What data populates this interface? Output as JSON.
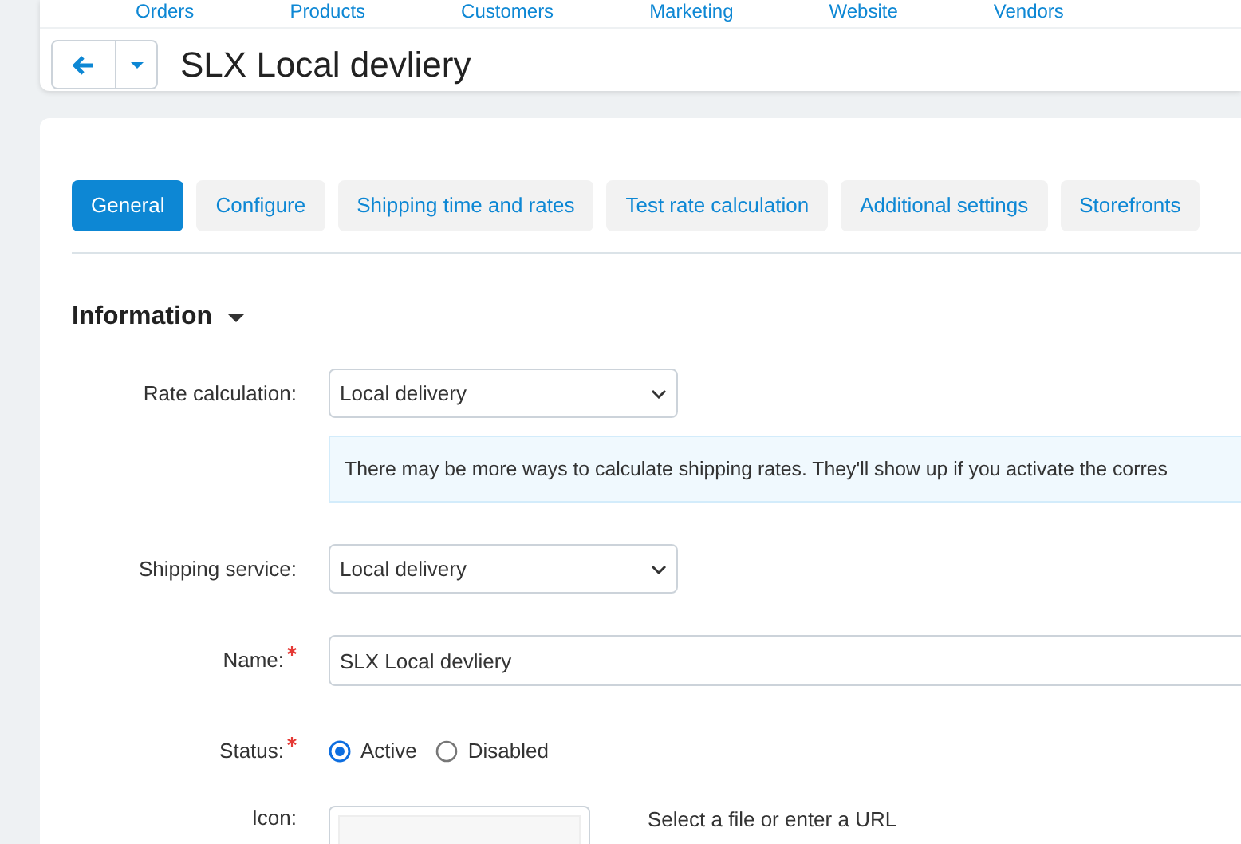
{
  "top_nav": [
    "Orders",
    "Products",
    "Customers",
    "Marketing",
    "Website",
    "Vendors"
  ],
  "header": {
    "title": "SLX Local devliery"
  },
  "tabs": [
    {
      "label": "General",
      "selected": true
    },
    {
      "label": "Configure",
      "selected": false
    },
    {
      "label": "Shipping time and rates",
      "selected": false
    },
    {
      "label": "Test rate calculation",
      "selected": false
    },
    {
      "label": "Additional settings",
      "selected": false
    },
    {
      "label": "Storefronts",
      "selected": false
    }
  ],
  "section": {
    "title": "Information",
    "expanded": true
  },
  "form": [
    {
      "kind": "select",
      "label": "Rate calculation:",
      "required": false,
      "value": "Local delivery",
      "note": "There may be more ways to calculate shipping rates. They'll show up if you activate the corres"
    },
    {
      "kind": "select",
      "label": "Shipping service:",
      "required": false,
      "value": "Local delivery"
    },
    {
      "kind": "text",
      "label": "Name:",
      "required": true,
      "value": "SLX Local devliery"
    },
    {
      "kind": "radio",
      "label": "Status:",
      "required": true,
      "options": [
        {
          "label": "Active",
          "selected": true
        },
        {
          "label": "Disabled",
          "selected": false
        }
      ]
    },
    {
      "kind": "file",
      "label": "Icon:",
      "required": false,
      "hint": "Select a file or enter a URL"
    }
  ]
}
